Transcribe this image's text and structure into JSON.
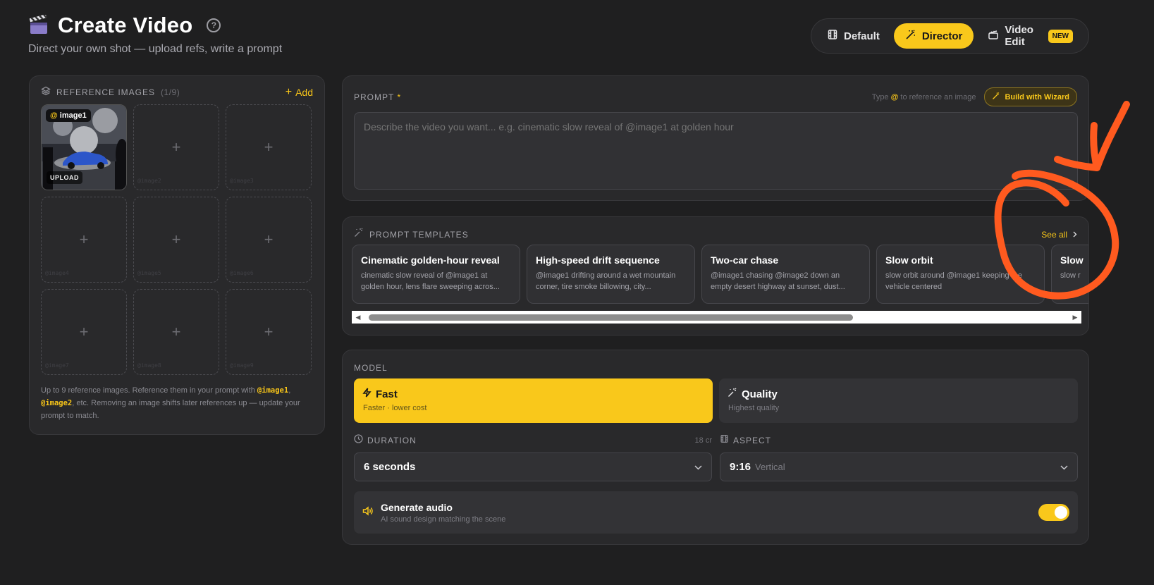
{
  "header": {
    "title": "Create Video",
    "subtitle": "Direct your own shot — upload refs, write a prompt",
    "help": "?"
  },
  "modes": {
    "default": "Default",
    "director": "Director",
    "video_edit": "Video Edit",
    "new_badge": "NEW",
    "active": "Director"
  },
  "references": {
    "title": "REFERENCE IMAGES",
    "count": "(1/9)",
    "add_label": "Add",
    "slots": [
      {
        "tag": "image1",
        "action": "UPLOAD",
        "filled": true
      },
      {
        "placeholder": "@image2"
      },
      {
        "placeholder": "@image3"
      },
      {
        "placeholder": "@image4"
      },
      {
        "placeholder": "@image5"
      },
      {
        "placeholder": "@image6"
      },
      {
        "placeholder": "@image7"
      },
      {
        "placeholder": "@image8"
      },
      {
        "placeholder": "@image9"
      }
    ],
    "note_a": "Up to 9 reference images. Reference them in your prompt with ",
    "note_code1": "@image1",
    "note_b": ", ",
    "note_code2": "@image2",
    "note_c": ", etc. Removing an image shifts later references up — update your prompt to match."
  },
  "prompt": {
    "label": "PROMPT",
    "required": "*",
    "hint_a": "Type",
    "hint_at": "@",
    "hint_b": "to reference an image",
    "wizard": "Build with Wizard",
    "placeholder": "Describe the video you want... e.g. cinematic slow reveal of @image1 at golden hour"
  },
  "templates": {
    "title": "PROMPT TEMPLATES",
    "see_all": "See all",
    "items": [
      {
        "title": "Cinematic golden-hour reveal",
        "desc": "cinematic slow reveal of @image1 at golden hour, lens flare sweeping acros..."
      },
      {
        "title": "High-speed drift sequence",
        "desc": "@image1 drifting around a wet mountain corner, tire smoke billowing, city..."
      },
      {
        "title": "Two-car chase",
        "desc": "@image1 chasing @image2 down an empty desert highway at sunset, dust..."
      },
      {
        "title": "Slow orbit",
        "desc": "slow orbit around @image1 keeping the vehicle centered"
      },
      {
        "title": "Slow",
        "desc": "slow r"
      }
    ],
    "scroll_fraction": 0.66
  },
  "model": {
    "label": "MODEL",
    "options": [
      {
        "name": "Fast",
        "sub": "Faster · lower cost",
        "selected": true
      },
      {
        "name": "Quality",
        "sub": "Highest quality",
        "selected": false
      }
    ]
  },
  "duration": {
    "label": "DURATION",
    "cost": "18 cr",
    "value": "6 seconds"
  },
  "aspect": {
    "label": "ASPECT",
    "value": "9:16",
    "sub": "Vertical"
  },
  "audio": {
    "title": "Generate audio",
    "sub": "AI sound design matching the scene",
    "enabled": true
  },
  "colors": {
    "accent": "#f9c81b",
    "background": "#1f1f20",
    "panel": "#29292b",
    "annotation": "#ff5a1f"
  },
  "icons": [
    "clapperboard-icon",
    "help-icon",
    "film-icon",
    "wand-icon",
    "video-edit-icon",
    "layers-icon",
    "plus-icon",
    "sparkles-icon",
    "chevron-right-icon",
    "bolt-icon",
    "clock-icon",
    "film-icon",
    "chevron-down-icon",
    "speaker-icon"
  ]
}
